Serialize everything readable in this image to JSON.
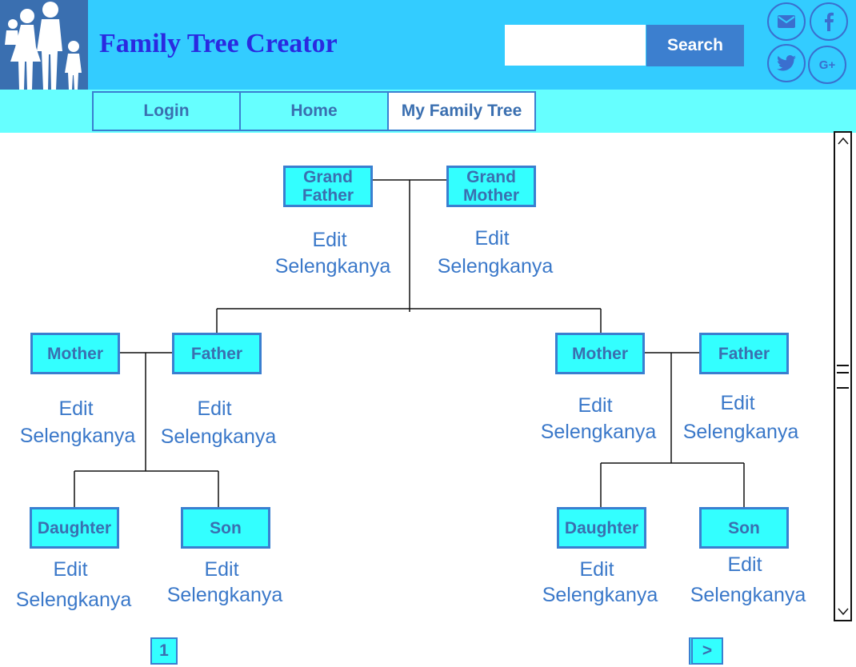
{
  "header": {
    "title": "Family Tree Creator",
    "logo_icon": "family-logo-icon",
    "search": {
      "value": "",
      "placeholder": "",
      "button_label": "Search"
    },
    "social_icons": [
      "mail-icon",
      "facebook-icon",
      "twitter-icon",
      "google-plus-icon"
    ],
    "social_labels": {
      "google_plus": "G+"
    }
  },
  "nav": {
    "tabs": [
      {
        "label": "Login"
      },
      {
        "label": "Home"
      },
      {
        "label": "My Family Tree",
        "active": true
      }
    ]
  },
  "tree": {
    "grandparents": [
      {
        "label": "Grand Father",
        "line1": "Grand",
        "line2": "Father",
        "edit": "Edit",
        "more": "Selengkanya"
      },
      {
        "label": "Grand Mother",
        "line1": "Grand",
        "line2": "Mother",
        "edit": "Edit",
        "more": "Selengkanya"
      }
    ],
    "left_family": {
      "mother": {
        "label": "Mother",
        "edit": "Edit",
        "more": "Selengkanya"
      },
      "father": {
        "label": "Father",
        "edit": "Edit",
        "more": "Selengkanya"
      },
      "daughter": {
        "label": "Daughter",
        "edit": "Edit",
        "more": "Selengkanya"
      },
      "son": {
        "label": "Son",
        "edit": "Edit",
        "more": "Selengkanya"
      }
    },
    "right_family": {
      "mother": {
        "label": "Mother",
        "edit": "Edit",
        "more": "Selengkanya"
      },
      "father": {
        "label": "Father",
        "edit": "Edit",
        "more": "Selengkanya"
      },
      "daughter": {
        "label": "Daughter",
        "edit": "Edit",
        "more": "Selengkanya"
      },
      "son": {
        "label": "Son",
        "edit": "Edit",
        "more": "Selengkanya"
      }
    }
  },
  "pagination": {
    "current": "1",
    "next": ">"
  },
  "colors": {
    "header_bg": "#33ccff",
    "nav_bg": "#66ffff",
    "node_bg": "#33ffff",
    "node_border": "#3a7fd0",
    "title": "#2a2ae0",
    "link": "#3a78c9",
    "search_button": "#3c7fcf"
  }
}
